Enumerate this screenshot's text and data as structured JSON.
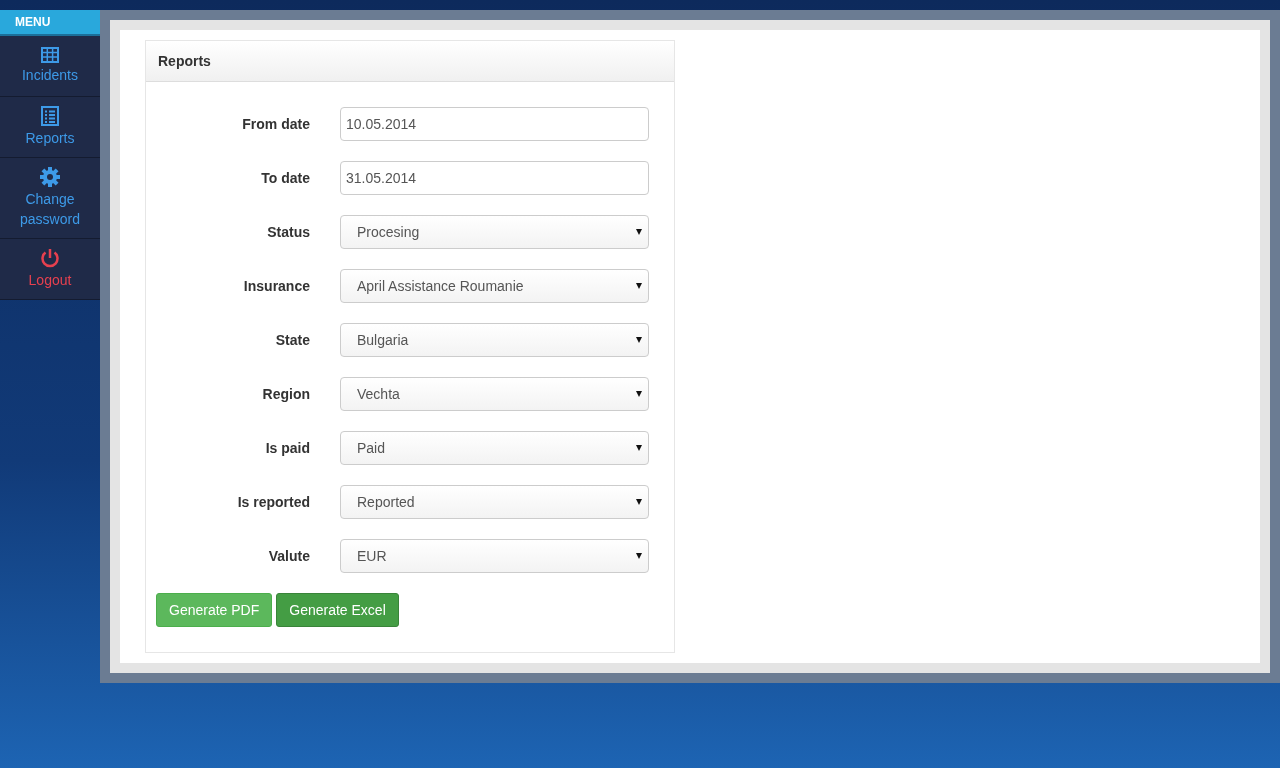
{
  "menu": {
    "title": "MENU",
    "items": [
      {
        "label": "Incidents",
        "kind": "grid"
      },
      {
        "label": "Reports",
        "kind": "list"
      },
      {
        "label": "Change password",
        "kind": "gear"
      },
      {
        "label": "Logout",
        "kind": "power"
      }
    ]
  },
  "panel": {
    "title": "Reports",
    "fields": [
      {
        "label": "From date",
        "kind": "text",
        "value": "10.05.2014"
      },
      {
        "label": "To date",
        "kind": "text",
        "value": "31.05.2014"
      },
      {
        "label": "Status",
        "kind": "select",
        "value": "Procesing"
      },
      {
        "label": "Insurance",
        "kind": "select",
        "value": "April Assistance Roumanie"
      },
      {
        "label": "State",
        "kind": "select",
        "value": "Bulgaria"
      },
      {
        "label": "Region",
        "kind": "select",
        "value": "Vechta"
      },
      {
        "label": "Is paid",
        "kind": "select",
        "value": "Paid"
      },
      {
        "label": "Is reported",
        "kind": "select",
        "value": "Reported"
      },
      {
        "label": "Valute",
        "kind": "select",
        "value": "EUR"
      }
    ],
    "buttons": [
      {
        "label": "Generate PDF",
        "active": false
      },
      {
        "label": "Generate Excel",
        "active": true
      }
    ]
  }
}
